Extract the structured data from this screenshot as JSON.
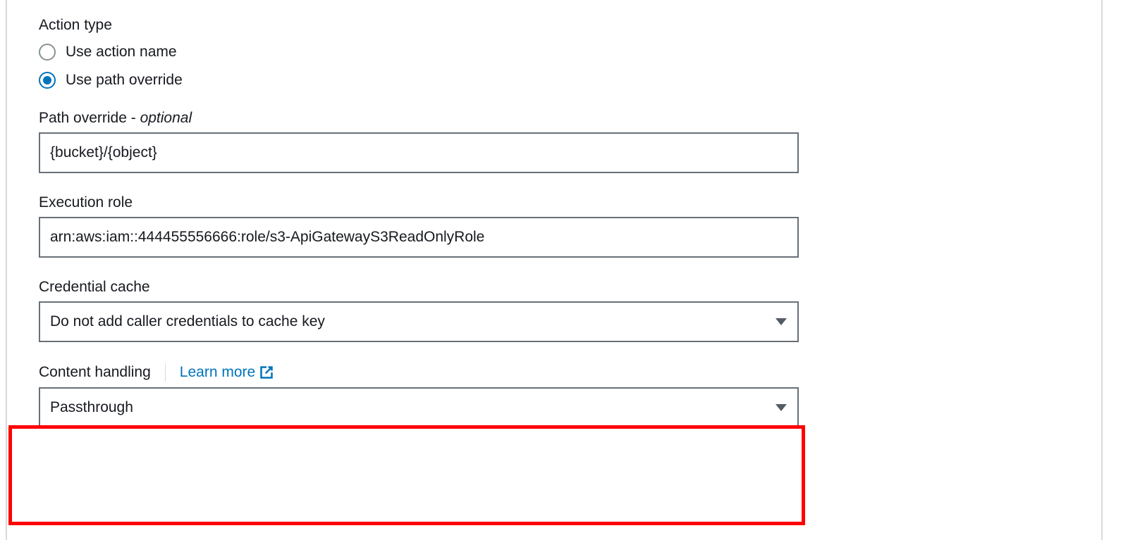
{
  "actionType": {
    "label": "Action type",
    "options": [
      {
        "label": "Use action name",
        "selected": false
      },
      {
        "label": "Use path override",
        "selected": true
      }
    ]
  },
  "pathOverride": {
    "label": "Path override - ",
    "optional": "optional",
    "value": "{bucket}/{object}"
  },
  "executionRole": {
    "label": "Execution role",
    "value": "arn:aws:iam::444455556666:role/s3-ApiGatewayS3ReadOnlyRole"
  },
  "credentialCache": {
    "label": "Credential cache",
    "selected": "Do not add caller credentials to cache key"
  },
  "contentHandling": {
    "label": "Content handling",
    "learnMore": "Learn more",
    "selected": "Passthrough"
  }
}
